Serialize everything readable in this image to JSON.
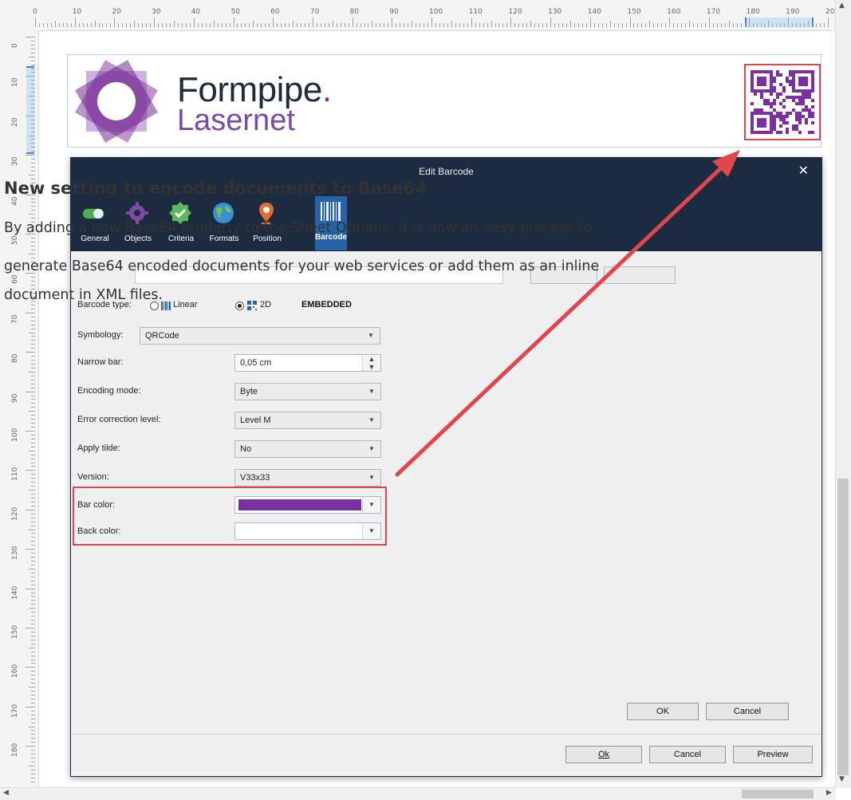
{
  "overlay": {
    "heading": "New setting to encode documents to Base64",
    "paragraph_lines": [
      "By adding a new Base64 property to the Sheet Options, it is now an easy process to",
      "generate Base64 encoded documents for your web services or add them as an inline",
      "document in XML files."
    ]
  },
  "ruler": {
    "horizontal_labels": [
      "0",
      "10",
      "20",
      "30",
      "40",
      "50",
      "60",
      "70",
      "80",
      "90",
      "100",
      "110",
      "120",
      "130",
      "140",
      "150",
      "160",
      "170",
      "180",
      "190",
      "20"
    ],
    "vertical_labels": [
      "0",
      "10",
      "20",
      "30",
      "40",
      "50",
      "60",
      "70",
      "80",
      "90",
      "100",
      "110",
      "120",
      "130",
      "140",
      "150",
      "160",
      "170",
      "180"
    ]
  },
  "page_header": {
    "brand_name": "Formpipe",
    "brand_dot": ".",
    "brand_sub": "Laserne",
    "brand_sub_end": "t"
  },
  "dialog": {
    "title": "Edit Barcode",
    "close_glyph": "✕",
    "tabs": [
      {
        "label": "General",
        "icon": "toggle-icon",
        "color": "#4caf50"
      },
      {
        "label": "Objects",
        "icon": "gear-icon",
        "color": "#7a4aa6"
      },
      {
        "label": "Criteria",
        "icon": "check-badge-icon",
        "color": "#5cb85c"
      },
      {
        "label": "Formats",
        "icon": "globe-icon",
        "color": "#3a8fd6"
      },
      {
        "label": "Position",
        "icon": "map-pin-icon",
        "color": "#e56b2e"
      },
      {
        "label": "Barcode",
        "icon": "barcode-icon",
        "color": "#2563a6",
        "active": true
      }
    ],
    "barcode_type_label": "Barcode type:",
    "barcode_type_options": [
      "Linear",
      "2D"
    ],
    "barcode_type_selected": "2D",
    "embedded_label": "EMBEDDED",
    "symbology_label": "Symbology:",
    "symbology_value": "QRCode",
    "rows": [
      {
        "label": "Narrow bar:",
        "value": "0,05 cm",
        "kind": "spin"
      },
      {
        "label": "Encoding mode:",
        "value": "Byte",
        "kind": "combo"
      },
      {
        "label": "Error correction level:",
        "value": "Level M",
        "kind": "combo"
      },
      {
        "label": "Apply tilde:",
        "value": "No",
        "kind": "combo"
      },
      {
        "label": "Version:",
        "value": "V33x33",
        "kind": "combo"
      }
    ],
    "bar_color_label": "Bar color:",
    "bar_color_value": "#7a2fa3",
    "back_color_label": "Back color:",
    "back_color_value": "#ffffff",
    "inner_buttons": {
      "ok": "OK",
      "cancel": "Cancel"
    },
    "footer_buttons": {
      "ok": "Ok",
      "cancel": "Cancel",
      "preview": "Preview"
    }
  },
  "colors": {
    "dialog_header": "#1c2b3f",
    "highlight_red": "#e0474c",
    "accent_purple": "#7a2fa3"
  }
}
